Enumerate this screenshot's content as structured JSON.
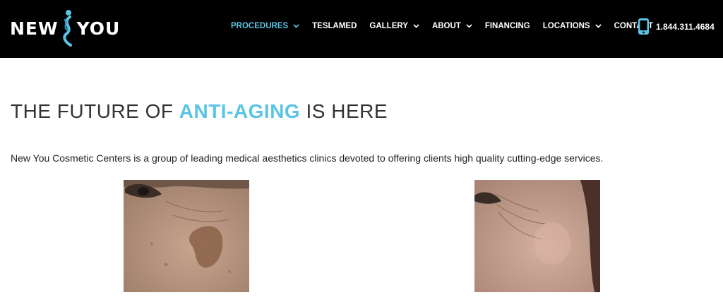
{
  "brand": {
    "logo_left": "NEW",
    "logo_right": "YOU",
    "logo_icon": "figure-swirl-icon",
    "accent_color": "#5bc4e6"
  },
  "nav": {
    "items": [
      {
        "label": "PROCEDURES",
        "dropdown": true,
        "active": true
      },
      {
        "label": "TESLAMED",
        "dropdown": false,
        "active": false
      },
      {
        "label": "GALLERY",
        "dropdown": true,
        "active": false
      },
      {
        "label": "ABOUT",
        "dropdown": true,
        "active": false
      },
      {
        "label": "FINANCING",
        "dropdown": false,
        "active": false
      },
      {
        "label": "LOCATIONS",
        "dropdown": true,
        "active": false
      },
      {
        "label": "CONTACT",
        "dropdown": false,
        "active": false
      }
    ],
    "phone": "1.844.311.4684",
    "phone_icon": "mobile-phone-icon"
  },
  "hero": {
    "headline_prefix": "THE FUTURE OF ",
    "headline_accent": "ANTI-AGING",
    "headline_suffix": " IS HERE",
    "intro": "New You Cosmetic Centers is a group of leading medical aesthetics clinics devoted to offering clients high quality cutting-edge services."
  },
  "photos": {
    "before": "before-photo",
    "after": "after-photo"
  }
}
